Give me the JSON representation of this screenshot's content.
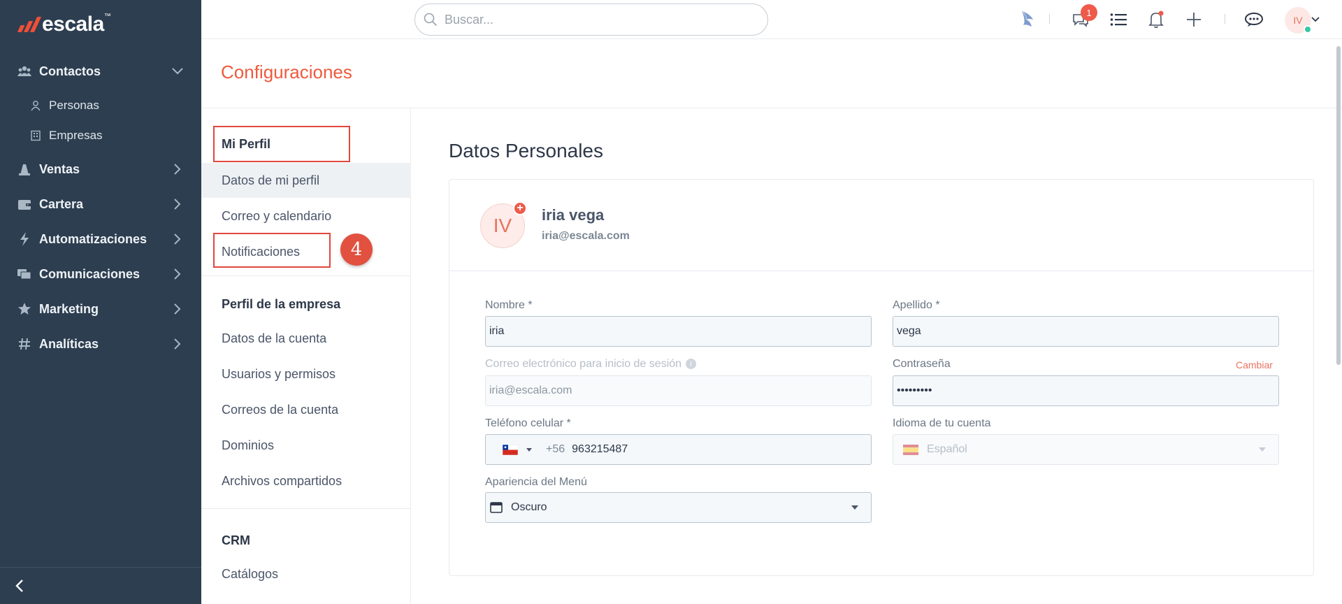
{
  "brand": {
    "name": "escala",
    "tm": "™"
  },
  "sidebar": {
    "contactos": {
      "label": "Contactos",
      "icon": "users-icon"
    },
    "sub": [
      {
        "label": "Personas",
        "icon": "person-icon"
      },
      {
        "label": "Empresas",
        "icon": "building-icon"
      }
    ],
    "items": [
      {
        "label": "Ventas",
        "icon": "funnel-icon"
      },
      {
        "label": "Cartera",
        "icon": "wallet-icon"
      },
      {
        "label": "Automatizaciones",
        "icon": "lightning-icon"
      },
      {
        "label": "Comunicaciones",
        "icon": "chat-icon"
      },
      {
        "label": "Marketing",
        "icon": "star-icon"
      },
      {
        "label": "Analíticas",
        "icon": "hashtag-icon"
      }
    ]
  },
  "topbar": {
    "search_placeholder": "Buscar...",
    "notifications_badge": "1",
    "avatar_initials": "IV"
  },
  "page": {
    "title": "Configuraciones"
  },
  "settings_nav": {
    "mi_perfil": "Mi Perfil",
    "perfil_items": [
      "Datos de mi perfil",
      "Correo y calendario",
      "Notificaciones"
    ],
    "empresa_heading": "Perfil de la empresa",
    "empresa_items": [
      "Datos de la cuenta",
      "Usuarios y permisos",
      "Correos de la cuenta",
      "Dominios",
      "Archivos compartidos"
    ],
    "crm_heading": "CRM",
    "crm_items": [
      "Catálogos"
    ],
    "step_number": "4"
  },
  "main": {
    "section_title": "Datos Personales",
    "profile": {
      "initials": "IV",
      "name": "iria vega",
      "email": "iria@escala.com"
    },
    "form": {
      "nombre_label": "Nombre *",
      "nombre_value": "iria",
      "apellido_label": "Apellido *",
      "apellido_value": "vega",
      "correo_label": "Correo electrónico para inicio de sesión",
      "correo_value": "iria@escala.com",
      "password_label": "Contraseña",
      "password_value": "•••••••••",
      "cambiar_label": "Cambiar",
      "telefono_label": "Teléfono celular *",
      "telefono_prefix": "+56",
      "telefono_value": "963215487",
      "idioma_label": "Idioma de tu cuenta",
      "idioma_value": "Español",
      "apariencia_label": "Apariencia del Menú",
      "apariencia_value": "Oscuro"
    }
  },
  "colors": {
    "accent": "#ee5a3e",
    "sidebar_bg": "#2d3e50",
    "badge": "#ef5a4a"
  }
}
